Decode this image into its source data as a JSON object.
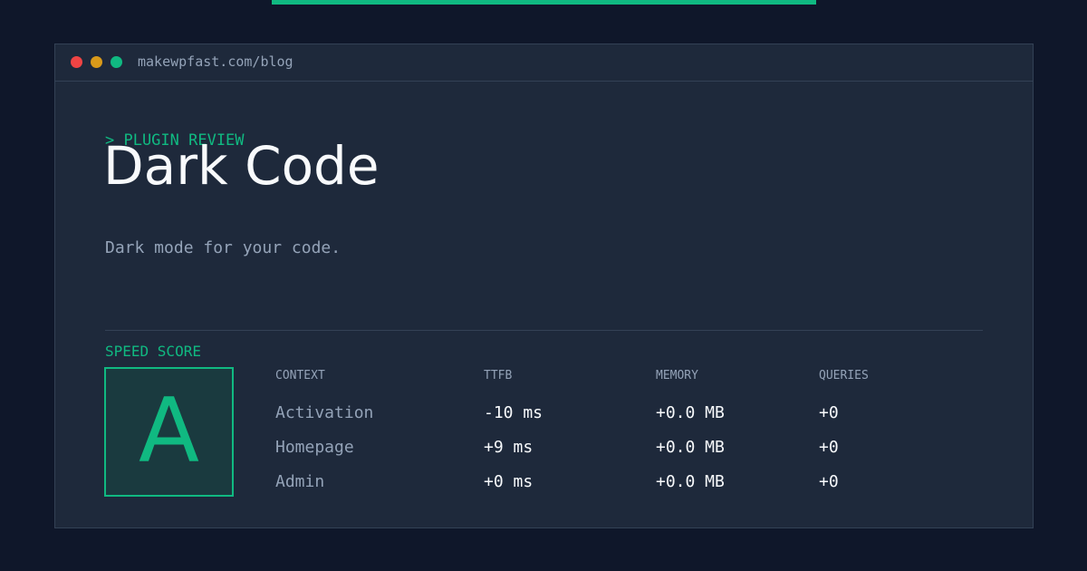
{
  "window": {
    "url": "makewpfast.com/blog"
  },
  "post": {
    "kicker": "> PLUGIN REVIEW",
    "title": "Dark Code",
    "subtitle": "Dark mode for your code."
  },
  "speed": {
    "label": "SPEED SCORE",
    "grade": "A"
  },
  "metrics": {
    "headers": {
      "context": "CONTEXT",
      "ttfb": "TTFB",
      "memory": "MEMORY",
      "queries": "QUERIES"
    },
    "rows": [
      {
        "context": "Activation",
        "ttfb": "-10 ms",
        "memory": "+0.0 MB",
        "queries": "+0"
      },
      {
        "context": "Homepage",
        "ttfb": "+9 ms",
        "memory": "+0.0 MB",
        "queries": "+0"
      },
      {
        "context": "Admin",
        "ttfb": "+0 ms",
        "memory": "+0.0 MB",
        "queries": "+0"
      }
    ]
  },
  "colors": {
    "background": "#0f172a",
    "panel": "#1e293b",
    "accent": "#10b981",
    "muted_text": "#94a3b8",
    "bright_text": "#f8fafc",
    "close_dot": "#ef4444",
    "minimize_dot": "#d99a1a",
    "maximize_dot": "#10b981"
  }
}
